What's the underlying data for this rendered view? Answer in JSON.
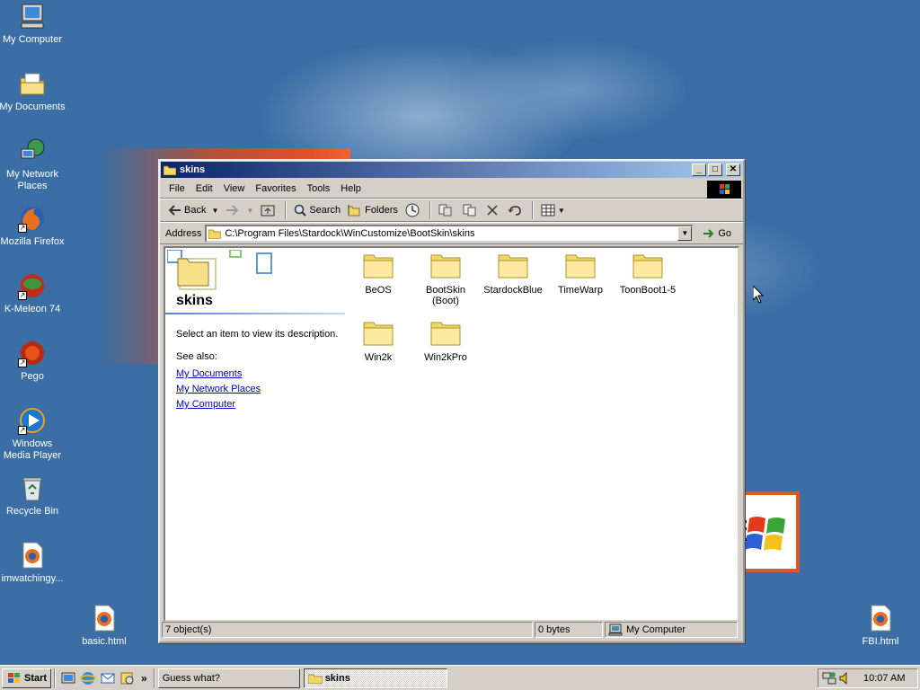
{
  "desktop": {
    "icons": [
      {
        "label": "My Computer"
      },
      {
        "label": "My Documents"
      },
      {
        "label": "My Network Places"
      },
      {
        "label": "Mozilla Firefox"
      },
      {
        "label": "K-Meleon 74"
      },
      {
        "label": "Pego"
      },
      {
        "label": "Windows Media Player"
      },
      {
        "label": "Recycle Bin"
      },
      {
        "label": "imwatchingy..."
      },
      {
        "label": "basic.html"
      },
      {
        "label": "FBI.html"
      }
    ]
  },
  "window": {
    "title": "skins",
    "menu": [
      "File",
      "Edit",
      "View",
      "Favorites",
      "Tools",
      "Help"
    ],
    "toolbar": {
      "back": "Back",
      "search": "Search",
      "folders": "Folders"
    },
    "address": {
      "label": "Address",
      "value": "C:\\Program Files\\Stardock\\WinCustomize\\BootSkin\\skins",
      "go": "Go"
    },
    "webview": {
      "title": "skins",
      "description": "Select an item to view its description.",
      "see_also": "See also:",
      "links": [
        "My Documents",
        "My Network Places",
        "My Computer"
      ]
    },
    "folders": [
      {
        "name": "BeOS"
      },
      {
        "name": "BootSkin (Boot)"
      },
      {
        "name": "StardockBlue"
      },
      {
        "name": "TimeWarp"
      },
      {
        "name": "ToonBoot1-5"
      },
      {
        "name": "Win2k"
      },
      {
        "name": "Win2kPro"
      }
    ],
    "status": {
      "objects": "7 object(s)",
      "size": "0 bytes",
      "zone": "My Computer"
    }
  },
  "taskbar": {
    "start": "Start",
    "tasks": [
      {
        "label": "Guess what?",
        "active": false
      },
      {
        "label": "skins",
        "active": true
      }
    ],
    "clock": "10:07 AM"
  },
  "colors": {
    "desktop": "#3a6ea5",
    "titlebar_start": "#0a246a",
    "titlebar_end": "#a6caf0",
    "face": "#d4d0c8",
    "link": "#0000cc"
  }
}
